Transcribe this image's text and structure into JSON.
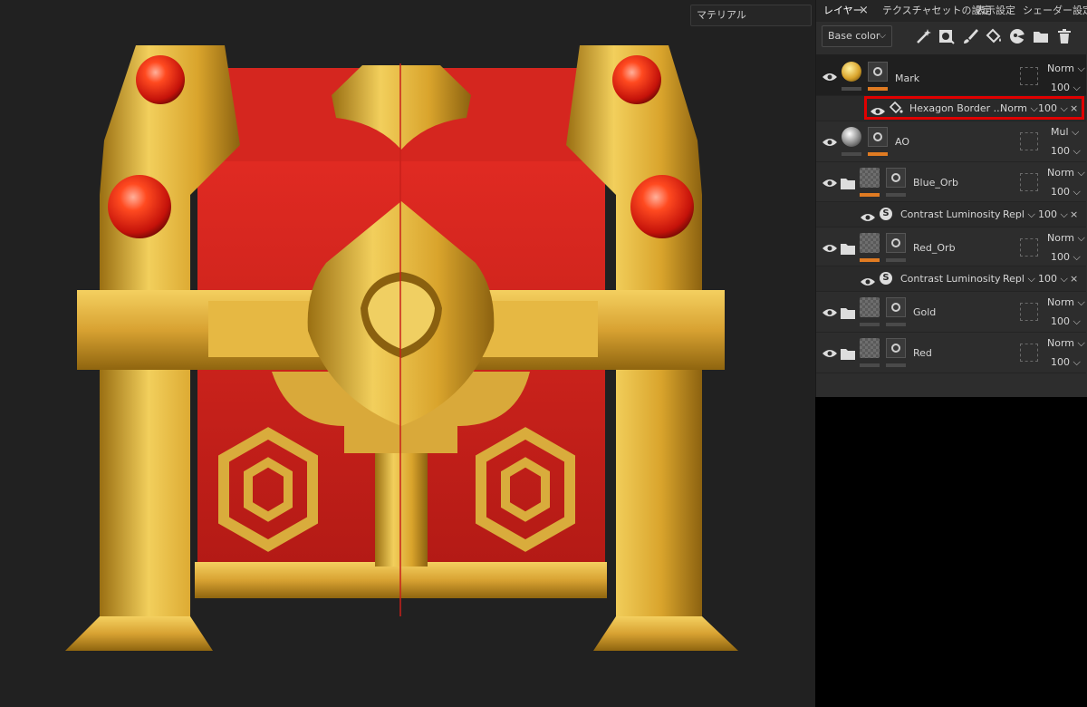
{
  "viewport": {
    "material_select": "マテリアル"
  },
  "tabs": [
    {
      "label": "レイヤー",
      "active": true
    },
    {
      "label": "テクスチャセットの設定",
      "active": false
    },
    {
      "label": "表示設定",
      "active": false
    },
    {
      "label": "シェーダー設定",
      "active": false
    }
  ],
  "toolbar": {
    "channel": "Base color",
    "tools": [
      "magic-wand-icon",
      "add-mask-icon",
      "brush-icon",
      "fill-icon",
      "smart-material-icon",
      "folder-icon",
      "trash-icon"
    ]
  },
  "layers": [
    {
      "name": "Mark",
      "blend": "Norm",
      "opacity": "100"
    },
    {
      "name": "Hexagon Border ...",
      "blend": "Norm",
      "opacity": "100"
    },
    {
      "name": "AO",
      "blend": "Mul",
      "opacity": "100"
    },
    {
      "name": "Blue_Orb",
      "blend": "Norm",
      "opacity": "100"
    },
    {
      "name": "Contrast Luminosity",
      "blend": "Repl",
      "opacity": "100"
    },
    {
      "name": "Red_Orb",
      "blend": "Norm",
      "opacity": "100"
    },
    {
      "name": "Contrast Luminosity",
      "blend": "Repl",
      "opacity": "100"
    },
    {
      "name": "Gold",
      "blend": "Norm",
      "opacity": "100"
    },
    {
      "name": "Red",
      "blend": "Norm",
      "opacity": "100"
    }
  ],
  "colors": {
    "gold": "#e0ad35",
    "red": "#d9251f",
    "accent": "#e07b22",
    "highlight": "#e00000"
  }
}
